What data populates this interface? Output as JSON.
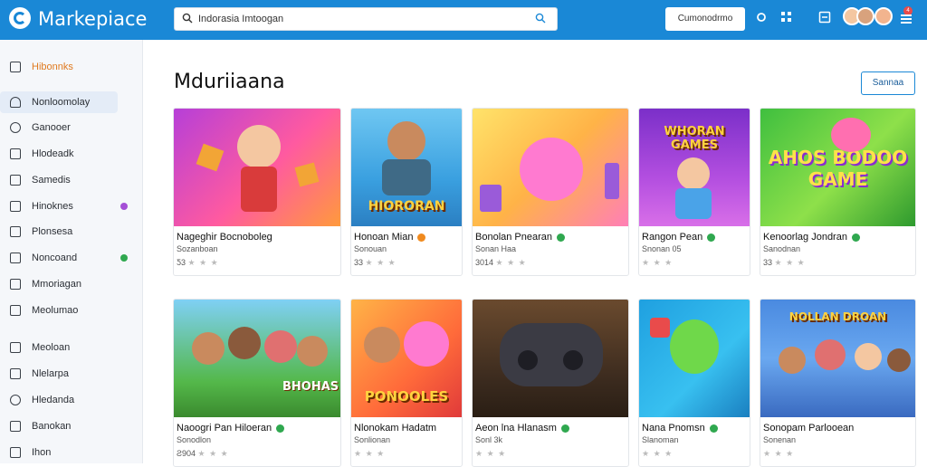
{
  "app": {
    "brand": "Markepiace",
    "search_value": "Indorasia Imtoogan",
    "top_button": "Cumonodrmo",
    "notification_count": "4"
  },
  "colors": {
    "topbar": "#1a88d6",
    "accent_orange": "#e07a1f",
    "verified_green": "#2fa84f"
  },
  "sidebar": {
    "items": [
      {
        "label": "Hibonnks",
        "icon": "image-icon"
      },
      {
        "label": "Nonloomolay",
        "icon": "bell-icon"
      },
      {
        "label": "Ganooer",
        "icon": "chat-icon"
      },
      {
        "label": "Hlodeadk",
        "icon": "tag-icon"
      },
      {
        "label": "Samedis",
        "icon": "grid-icon"
      },
      {
        "label": "Hinoknes",
        "icon": "document-icon"
      },
      {
        "label": "Plonsesa",
        "icon": "calendar-icon"
      },
      {
        "label": "Noncoand",
        "icon": "globe-icon"
      },
      {
        "label": "Mmoriagan",
        "icon": "list-icon"
      },
      {
        "label": "Meolumao",
        "icon": "folder-icon"
      },
      {
        "label": "Meoloan",
        "icon": "user-icon"
      },
      {
        "label": "Nlelarpa",
        "icon": "bookmark-icon"
      },
      {
        "label": "Hledanda",
        "icon": "settings-icon"
      },
      {
        "label": "Banokan",
        "icon": "box-icon"
      },
      {
        "label": "Ihon",
        "icon": "star-icon"
      }
    ]
  },
  "main": {
    "title": "Mduriiaana",
    "see_all": "Sannaa",
    "cards": [
      {
        "name": "Nageghir Bocnoboleg",
        "sub": "Sozanboan",
        "rating": "Ƽ3"
      },
      {
        "name": "Honoan Mian",
        "sub": "Sonouan",
        "rating": "33"
      },
      {
        "name": "Bonolan Pnearan",
        "sub": "Sonan Haa",
        "rating": "3014"
      },
      {
        "name": "Rangon Pean",
        "sub": "Snonan 05",
        "rating": ""
      },
      {
        "name": "Kenoorlag Jondran",
        "sub": "Sanodnan",
        "rating": "33"
      },
      {
        "name": "Naoogri Pan Hiloeran",
        "sub": "Sonodlon",
        "rating": "Ƨ904"
      },
      {
        "name": "Nlonokam Hadatm",
        "sub": "Sonlionan",
        "rating": ""
      },
      {
        "name": "Aeon lna Hlanasm",
        "sub": "Sonl 3k",
        "rating": ""
      },
      {
        "name": "Nana Pnomsn",
        "sub": "Slanoman",
        "rating": ""
      },
      {
        "name": "Sonopam Parlooean",
        "sub": "Sonenan",
        "rating": ""
      }
    ],
    "card_stars": "★ ★ ★",
    "thumb_labels": [
      "",
      "HIORORAN",
      "",
      "WHORAN GAMES",
      "AHOS BODOO GAME",
      "BHOHAS",
      "PONOOLES",
      "",
      "",
      "NOLLAN DROAN"
    ]
  }
}
